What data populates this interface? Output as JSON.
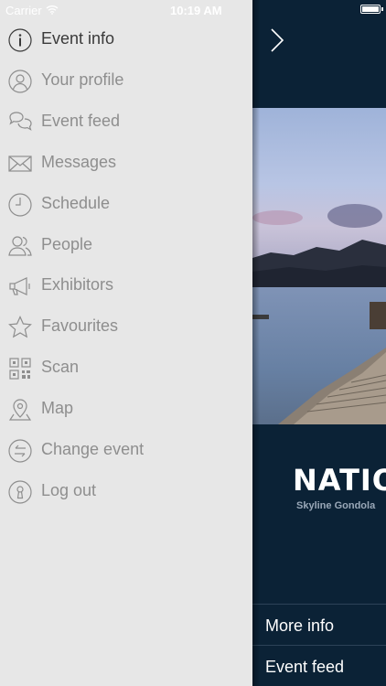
{
  "status_bar": {
    "carrier": "Carrier",
    "time": "10:19 AM"
  },
  "menu": {
    "items": [
      {
        "label": "Event info",
        "icon": "info-icon",
        "active": true
      },
      {
        "label": "Your profile",
        "icon": "profile-icon"
      },
      {
        "label": "Event feed",
        "icon": "chat-bubbles-icon"
      },
      {
        "label": "Messages",
        "icon": "envelope-icon"
      },
      {
        "label": "Schedule",
        "icon": "clock-icon"
      },
      {
        "label": "People",
        "icon": "people-icon"
      },
      {
        "label": "Exhibitors",
        "icon": "megaphone-icon"
      },
      {
        "label": "Favourites",
        "icon": "star-icon"
      },
      {
        "label": "Scan",
        "icon": "qr-code-icon"
      },
      {
        "label": "Map",
        "icon": "map-pin-icon"
      },
      {
        "label": "Change event",
        "icon": "swap-icon"
      },
      {
        "label": "Log out",
        "icon": "keyhole-icon"
      }
    ]
  },
  "panel": {
    "brand": "NATION",
    "brand_sub": "Skyline Gondola",
    "rows": [
      {
        "label": "More info"
      },
      {
        "label": "Event feed"
      }
    ]
  },
  "colors": {
    "menu_bg": "#e7e7e7",
    "panel_bg": "#0b2236",
    "menu_text": "#8e8e8e",
    "active_text": "#3a3a3a"
  }
}
